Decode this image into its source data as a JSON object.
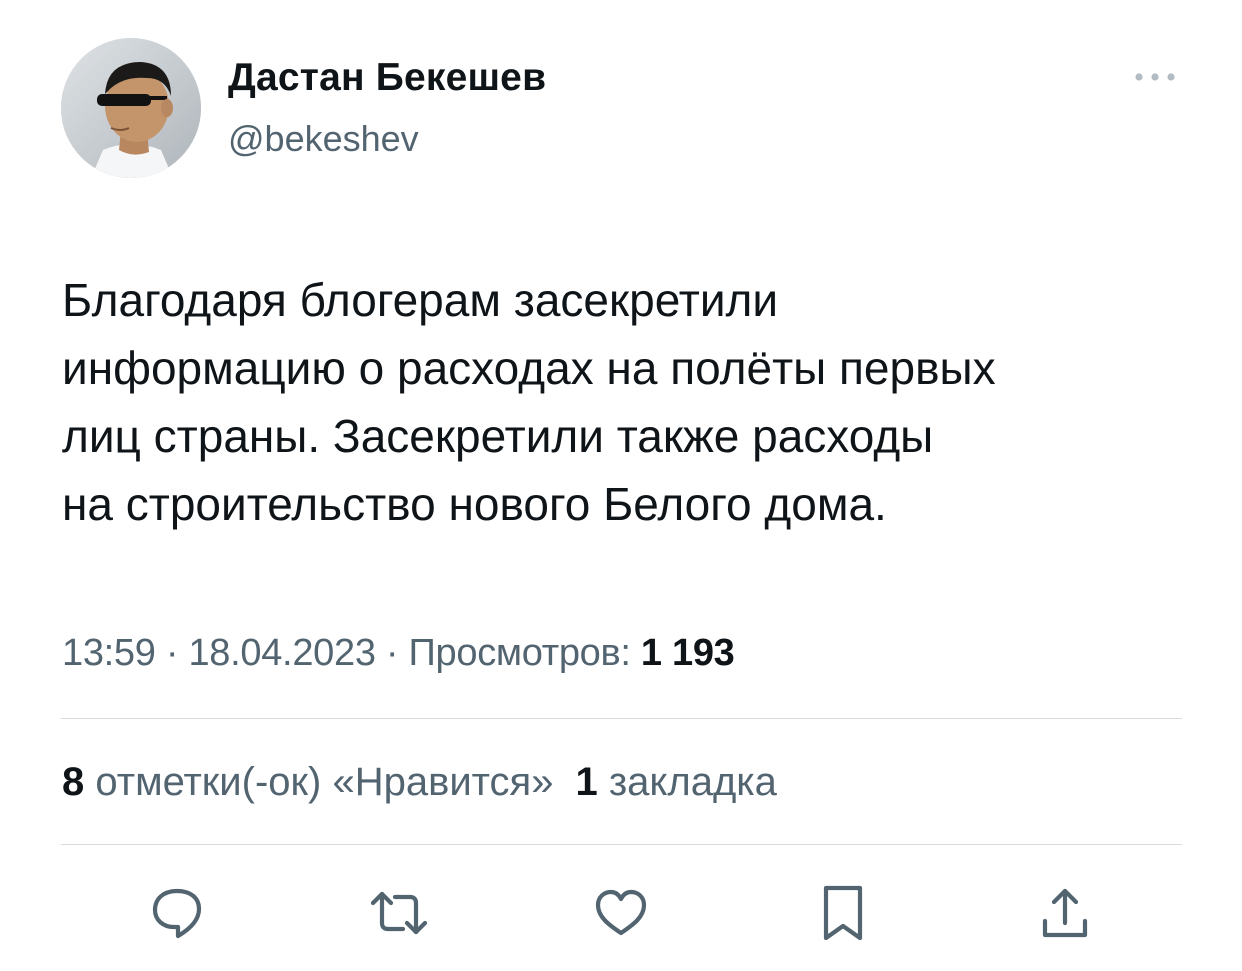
{
  "author": {
    "display_name": "Дастан Бекешев",
    "handle": "@bekeshev"
  },
  "tweet": {
    "text_lines": [
      "Благодаря блогерам засекретили",
      "информацию о расходах на полёты первых",
      "лиц страны. Засекретили также расходы",
      "на строительство нового Белого дома."
    ]
  },
  "meta": {
    "time": "13:59",
    "separator": " · ",
    "date": "18.04.2023",
    "views_label": "Просмотров:",
    "views_count": "1 193"
  },
  "stats": {
    "likes_count": "8",
    "likes_label": "отметки(-ок) «Нравится»",
    "bookmarks_count": "1",
    "bookmarks_label": "закладка"
  },
  "icons": {
    "more": "more-dots-icon",
    "reply": "reply-bubble-icon",
    "retweet": "retweet-icon",
    "like": "heart-icon",
    "bookmark": "bookmark-icon",
    "share": "share-upload-icon"
  },
  "colors": {
    "primary_text": "#0f1419",
    "secondary_text": "#536471",
    "divider": "#d6dbdf",
    "icon": "#536471"
  }
}
